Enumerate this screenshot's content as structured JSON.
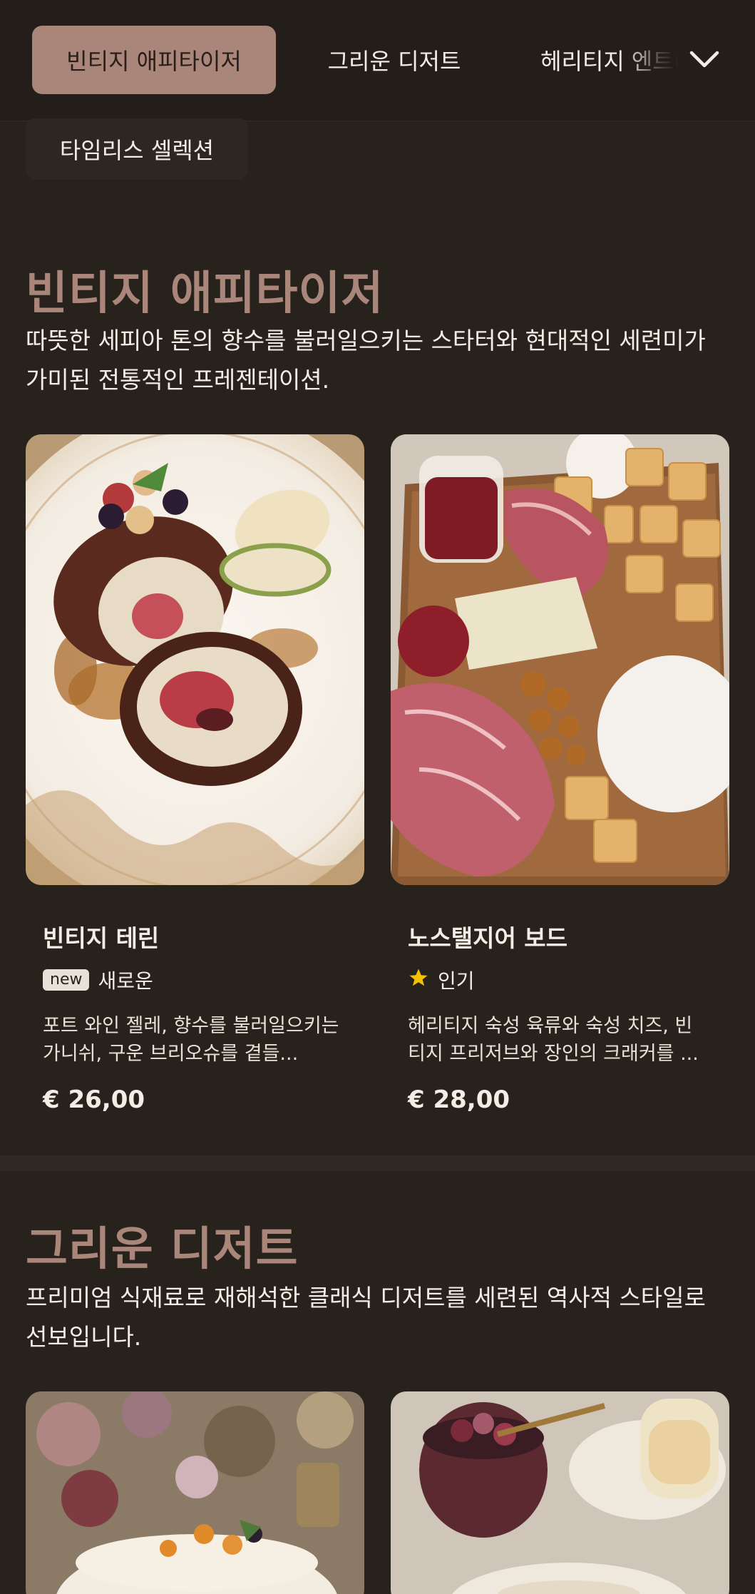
{
  "nav": {
    "tabs": [
      {
        "label": "빈티지 애피타이저",
        "active": true
      },
      {
        "label": "그리운 디저트",
        "active": false
      },
      {
        "label": "헤리티지 엔트리",
        "active": false
      }
    ],
    "second_row_tab": "타임리스 셀렉션",
    "dropdown_icon": "chevron-down-icon"
  },
  "sections": [
    {
      "title": "빈티지 애피타이저",
      "description": "따뜻한 세피아 톤의 향수를 불러일으키는 스타터와 현대적인 세련미가 가미된 전통적인 프레젠테이션.",
      "items": [
        {
          "name": "빈티지 테린",
          "badge": "new",
          "tag": "새로운",
          "description": "포트 와인 젤레, 향수를 불러일으키는 가니쉬, 구운 브리오슈를 곁들...",
          "price": "€ 26,00"
        },
        {
          "name": "노스탤지어 보드",
          "badge_icon": "star-icon",
          "tag": "인기",
          "description": "헤리티지 숙성 육류와 숙성 치즈, 빈티지 프리저브와 장인의 크래커를 ...",
          "price": "€ 28,00"
        }
      ]
    },
    {
      "title": "그리운 디저트",
      "description": "프리미엄 식재료로 재해석한 클래식 디저트를 세련된 역사적 스타일로 선보입니다."
    }
  ],
  "colors": {
    "background": "#27221c",
    "accent": "#a9857a",
    "text": "#f3ede6",
    "star": "#f2c200"
  }
}
